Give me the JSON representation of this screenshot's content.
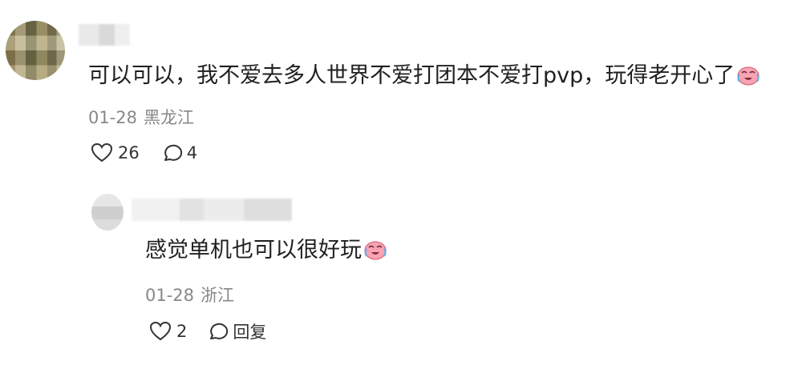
{
  "comment": {
    "text": "可以可以，我不爱去多人世界不爱打团本不爱打pvp，玩得老开心了",
    "emoji": "crying-laughing-emoji",
    "date": "01-28",
    "location": "黑龙江",
    "likes": "26",
    "replies": "4"
  },
  "reply": {
    "text": "感觉单机也可以很好玩",
    "emoji": "crying-laughing-emoji",
    "date": "01-28",
    "location": "浙江",
    "likes": "2",
    "reply_label": "回复"
  },
  "icons": [
    "heart-icon",
    "comment-icon"
  ],
  "colors": {
    "text": "#1f1f1f",
    "meta": "#888888",
    "emoji": "#f08aa0"
  }
}
